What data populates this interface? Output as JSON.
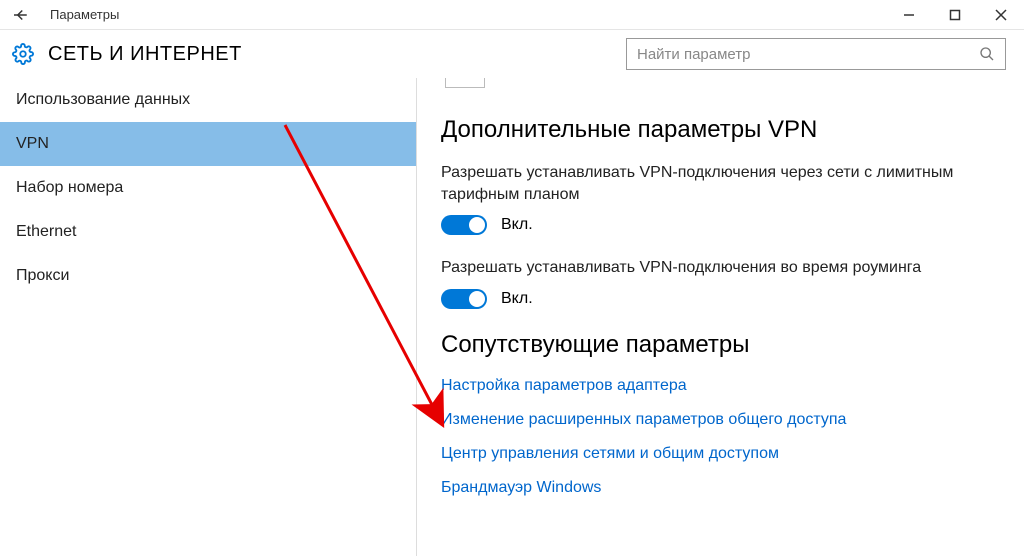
{
  "window": {
    "title": "Параметры"
  },
  "header": {
    "page_title": "СЕТЬ И ИНТЕРНЕТ",
    "search_placeholder": "Найти параметр"
  },
  "sidebar": {
    "items": [
      "Использование данных",
      "VPN",
      "Набор номера",
      "Ethernet",
      "Прокси"
    ]
  },
  "main": {
    "section_title": "Дополнительные параметры VPN",
    "setting1": {
      "desc": "Разрешать устанавливать VPN-подключения через сети с лимитным тарифным планом",
      "state": "Вкл."
    },
    "setting2": {
      "desc": "Разрешать устанавливать VPN-подключения во время роуминга",
      "state": "Вкл."
    },
    "related_title": "Сопутствующие параметры",
    "links": [
      "Настройка параметров адаптера",
      "Изменение расширенных параметров общего доступа",
      "Центр управления сетями и общим доступом",
      "Брандмауэр Windows"
    ]
  }
}
